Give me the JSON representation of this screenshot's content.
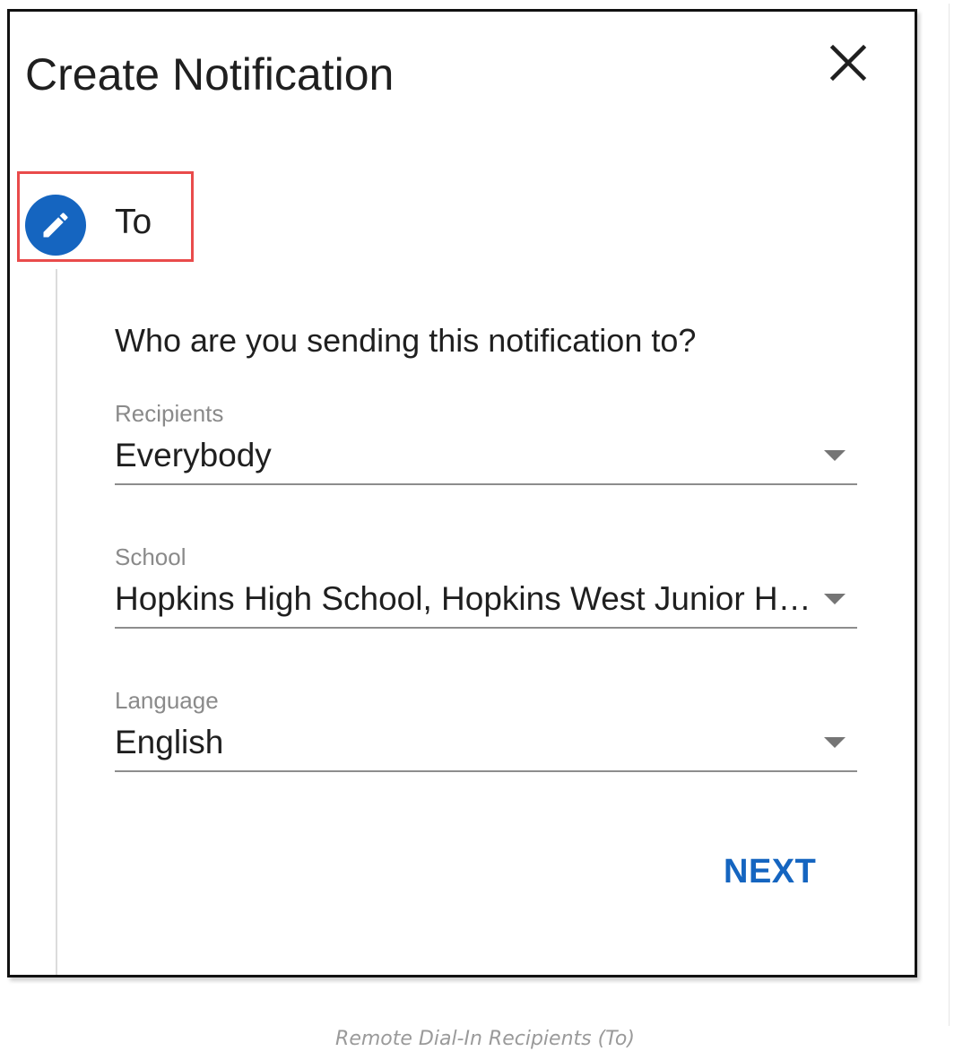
{
  "dialog": {
    "title": "Create Notification",
    "close_icon": "close-icon"
  },
  "step": {
    "icon": "pencil-icon",
    "label": "To",
    "accent_color": "#1565c0",
    "highlight_color": "#e94b4b"
  },
  "form": {
    "question": "Who are you sending this notification to?",
    "fields": [
      {
        "label": "Recipients",
        "value": "Everybody",
        "icon": "chevron-down-icon"
      },
      {
        "label": "School",
        "value": "Hopkins High School, Hopkins West Junior High",
        "icon": "chevron-down-icon"
      },
      {
        "label": "Language",
        "value": "English",
        "icon": "chevron-down-icon"
      }
    ],
    "next_label": "NEXT"
  },
  "caption": "Remote Dial-In Recipients (To)"
}
